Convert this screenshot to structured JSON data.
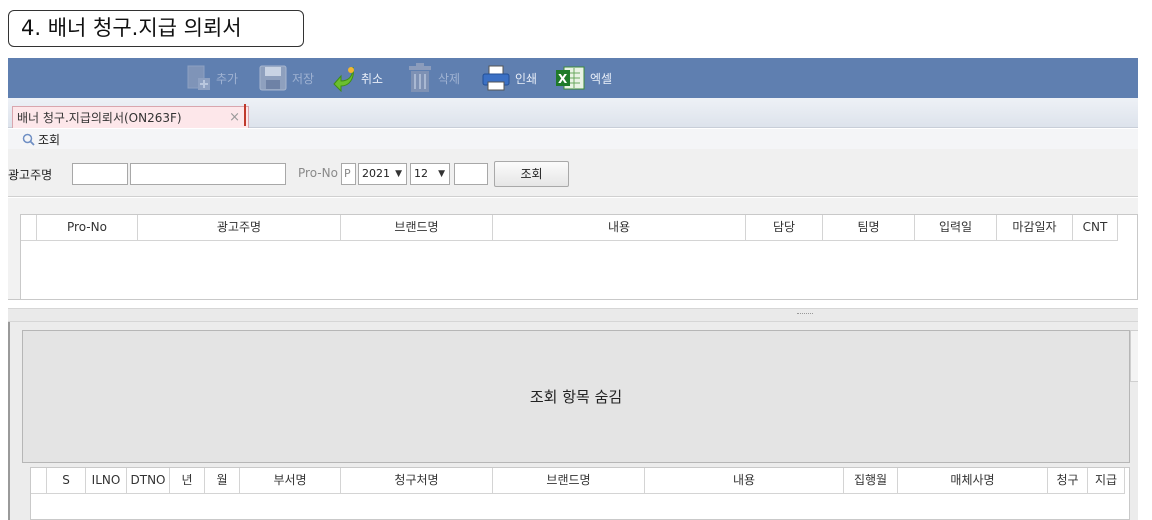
{
  "page_title": "4. 배너 청구.지급 의뢰서",
  "toolbar": {
    "buttons": [
      {
        "label": "추가",
        "icon": "add-document-icon",
        "enabled": false
      },
      {
        "label": "저장",
        "icon": "save-disk-icon",
        "enabled": false
      },
      {
        "label": "취소",
        "icon": "undo-arrow-icon",
        "enabled": true
      },
      {
        "label": "삭제",
        "icon": "trash-icon",
        "enabled": false
      },
      {
        "label": "인쇄",
        "icon": "printer-icon",
        "enabled": true
      },
      {
        "label": "엑셀",
        "icon": "excel-icon",
        "enabled": true
      }
    ],
    "colors": {
      "bar": "#5f7fb0"
    }
  },
  "tab": {
    "label": "배너 청구.지급의뢰서(ON263F)",
    "close": "×"
  },
  "search": {
    "header_label": "조회",
    "advertiser_label": "광고주명",
    "pro_no_label": "Pro-No",
    "pro_no_prefix": "P",
    "year": "2021",
    "month": "12",
    "search_button": "조회"
  },
  "grid1": {
    "columns": [
      "Pro-No",
      "광고주명",
      "브랜드명",
      "내용",
      "담당",
      "팀명",
      "입력일",
      "마감일자",
      "CNT"
    ]
  },
  "hidden_panel": {
    "text": "조회 항목 숨김"
  },
  "grid2": {
    "columns": [
      "S",
      "ILNO",
      "DTNO",
      "년",
      "월",
      "부서명",
      "청구처명",
      "브랜드명",
      "내용",
      "집행월",
      "매체사명",
      "청구",
      "지급"
    ]
  }
}
